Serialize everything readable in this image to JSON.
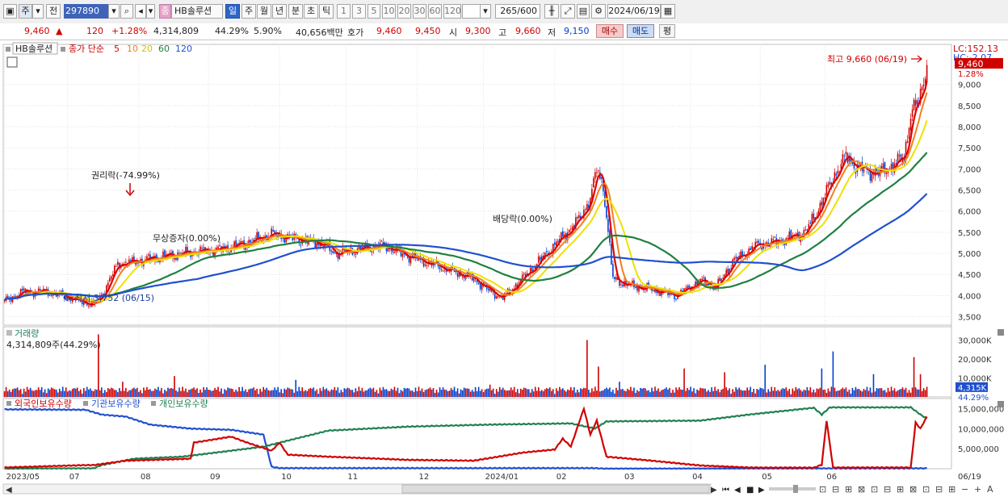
{
  "toolbar": {
    "period_label": "주",
    "prev_label": "전",
    "stock_code": "297890",
    "stock_name": "HB솔루션",
    "stock_badge": "종",
    "period_tabs": [
      "일",
      "주",
      "월",
      "년",
      "분",
      "초",
      "틱"
    ],
    "intervals": [
      "1",
      "3",
      "5",
      "10",
      "20",
      "30",
      "60",
      "120"
    ],
    "count": "265",
    "count_total": "/600",
    "date": "2024/06/19"
  },
  "quote": {
    "price": "9,460",
    "change": "120",
    "change_pct": "+1.28%",
    "volume": "4,314,809",
    "vol_ratio": "44.29%",
    "turnover_pct": "5.90%",
    "amount": "40,656백만",
    "bid_label": "호가",
    "ask": "9,460",
    "bid": "9,450",
    "open_label": "시",
    "open": "9,300",
    "high_label": "고",
    "high": "9,660",
    "low_label": "저",
    "low": "9,150",
    "buy_label": "매수",
    "sell_label": "매도",
    "avg_label": "평"
  },
  "legend": {
    "stock": "HB솔루션",
    "ma_label": "종가 단순",
    "ma_periods": [
      "5",
      "10",
      "20",
      "60",
      "120"
    ]
  },
  "annotations": {
    "high_note": "최고 9,660 (06/19)",
    "low_note": "최저 3,752 (06/15)",
    "rights": "권리락(-74.99%)",
    "free_issue": "무상증자(0.00%)",
    "dividend": "배당락(0.00%)",
    "lc": "LC:152.13",
    "hc": "HC:-2.07",
    "price_tag": "9,460",
    "pct_tag": "1.28%"
  },
  "volume_panel": {
    "title": "거래량",
    "value": "4,314,809주(44.29%)",
    "tag": "4,315K",
    "pct": "44.29%",
    "ticks": [
      "30,000K",
      "20,000K",
      "10,000K"
    ]
  },
  "holdings_panel": {
    "series": [
      "외국인보유수량",
      "기관보유수량",
      "개인보유수량"
    ],
    "ticks": [
      "15,000,000",
      "10,000,000",
      "5,000,000"
    ]
  },
  "price_ticks": [
    "9,000",
    "8,500",
    "8,000",
    "7,500",
    "7,000",
    "6,500",
    "6,000",
    "5,500",
    "5,000",
    "4,500",
    "4,000",
    "3,500"
  ],
  "x_labels": [
    "2023/05",
    "07",
    "08",
    "09",
    "10",
    "11",
    "12",
    "2024/01",
    "02",
    "03",
    "04",
    "05",
    "06"
  ],
  "x_end_label": "06/19",
  "colors": {
    "up": "#d00000",
    "down": "#0040d0",
    "ma5": "#e00000",
    "ma10": "#f08020",
    "ma20": "#f0e000",
    "ma60": "#208040",
    "ma120": "#2050d0"
  },
  "chart_data": {
    "type": "candlestick",
    "price_axis": [
      3300,
      9950
    ],
    "anchors": [
      [
        0,
        3850
      ],
      [
        10,
        4080
      ],
      [
        25,
        4100
      ],
      [
        40,
        3950
      ],
      [
        55,
        3780
      ],
      [
        60,
        4000
      ],
      [
        70,
        4750
      ],
      [
        80,
        4800
      ],
      [
        95,
        4900
      ],
      [
        110,
        5000
      ],
      [
        120,
        5050
      ],
      [
        135,
        5100
      ],
      [
        150,
        5250
      ],
      [
        165,
        5450
      ],
      [
        180,
        5350
      ],
      [
        195,
        5250
      ],
      [
        205,
        5000
      ],
      [
        220,
        5100
      ],
      [
        235,
        5200
      ],
      [
        245,
        5000
      ],
      [
        260,
        4800
      ],
      [
        275,
        4600
      ],
      [
        290,
        4400
      ],
      [
        300,
        4100
      ],
      [
        308,
        3950
      ],
      [
        320,
        4400
      ],
      [
        335,
        5000
      ],
      [
        345,
        5400
      ],
      [
        355,
        5800
      ],
      [
        362,
        6300
      ],
      [
        366,
        7000
      ],
      [
        370,
        6600
      ],
      [
        373,
        5500
      ],
      [
        376,
        4400
      ],
      [
        385,
        4250
      ],
      [
        400,
        4150
      ],
      [
        415,
        4000
      ],
      [
        430,
        4350
      ],
      [
        440,
        4200
      ],
      [
        450,
        4800
      ],
      [
        465,
        5200
      ],
      [
        480,
        5300
      ],
      [
        495,
        5500
      ],
      [
        505,
        6200
      ],
      [
        512,
        6800
      ],
      [
        520,
        7300
      ],
      [
        528,
        7000
      ],
      [
        540,
        6900
      ],
      [
        550,
        7100
      ],
      [
        556,
        7300
      ],
      [
        560,
        8300
      ],
      [
        565,
        8600
      ],
      [
        570,
        9460
      ]
    ],
    "volume_spikes": [
      [
        58,
        33000
      ],
      [
        73,
        8000
      ],
      [
        105,
        11000
      ],
      [
        180,
        9000
      ],
      [
        300,
        6500
      ],
      [
        360,
        30000
      ],
      [
        367,
        16000
      ],
      [
        380,
        8000
      ],
      [
        420,
        15000
      ],
      [
        445,
        13000
      ],
      [
        470,
        17000
      ],
      [
        505,
        15000
      ],
      [
        512,
        24000
      ],
      [
        537,
        12000
      ],
      [
        562,
        21000
      ],
      [
        566,
        12000
      ]
    ],
    "foreign": [
      [
        0,
        300000
      ],
      [
        50,
        900000
      ],
      [
        55,
        900000
      ],
      [
        75,
        2000000
      ],
      [
        115,
        2500000
      ],
      [
        117,
        6500000
      ],
      [
        140,
        8000000
      ],
      [
        150,
        6500000
      ],
      [
        165,
        4500000
      ],
      [
        170,
        6500000
      ],
      [
        175,
        3500000
      ],
      [
        200,
        3000000
      ],
      [
        250,
        2200000
      ],
      [
        290,
        2000000
      ],
      [
        320,
        4000000
      ],
      [
        340,
        4800000
      ],
      [
        345,
        7500000
      ],
      [
        350,
        5500000
      ],
      [
        358,
        15000000
      ],
      [
        362,
        8500000
      ],
      [
        366,
        12000000
      ],
      [
        372,
        3000000
      ],
      [
        400,
        2000000
      ],
      [
        430,
        800000
      ],
      [
        460,
        300000
      ],
      [
        500,
        250000
      ],
      [
        505,
        1000000
      ],
      [
        508,
        12000000
      ],
      [
        512,
        300000
      ],
      [
        560,
        300000
      ],
      [
        563,
        11500000
      ],
      [
        566,
        10000000
      ],
      [
        570,
        13000000
      ]
    ],
    "institution": [
      [
        0,
        14800000
      ],
      [
        50,
        14700000
      ],
      [
        60,
        13500000
      ],
      [
        75,
        13000000
      ],
      [
        90,
        11000000
      ],
      [
        115,
        10000000
      ],
      [
        140,
        9700000
      ],
      [
        160,
        8500000
      ],
      [
        165,
        500000
      ],
      [
        170,
        150000
      ],
      [
        300,
        150000
      ],
      [
        365,
        150000
      ],
      [
        370,
        0
      ],
      [
        570,
        100000
      ]
    ],
    "individual": [
      [
        0,
        0
      ],
      [
        55,
        100000
      ],
      [
        60,
        900000
      ],
      [
        80,
        2500000
      ],
      [
        110,
        3000000
      ],
      [
        140,
        4500000
      ],
      [
        160,
        5500000
      ],
      [
        170,
        6500000
      ],
      [
        200,
        9500000
      ],
      [
        250,
        10500000
      ],
      [
        300,
        11000000
      ],
      [
        350,
        11300000
      ],
      [
        365,
        10000000
      ],
      [
        372,
        11800000
      ],
      [
        430,
        12000000
      ],
      [
        460,
        13500000
      ],
      [
        500,
        15200000
      ],
      [
        505,
        13500000
      ],
      [
        510,
        15300000
      ],
      [
        560,
        15300000
      ],
      [
        566,
        13500000
      ],
      [
        570,
        12500000
      ]
    ]
  }
}
